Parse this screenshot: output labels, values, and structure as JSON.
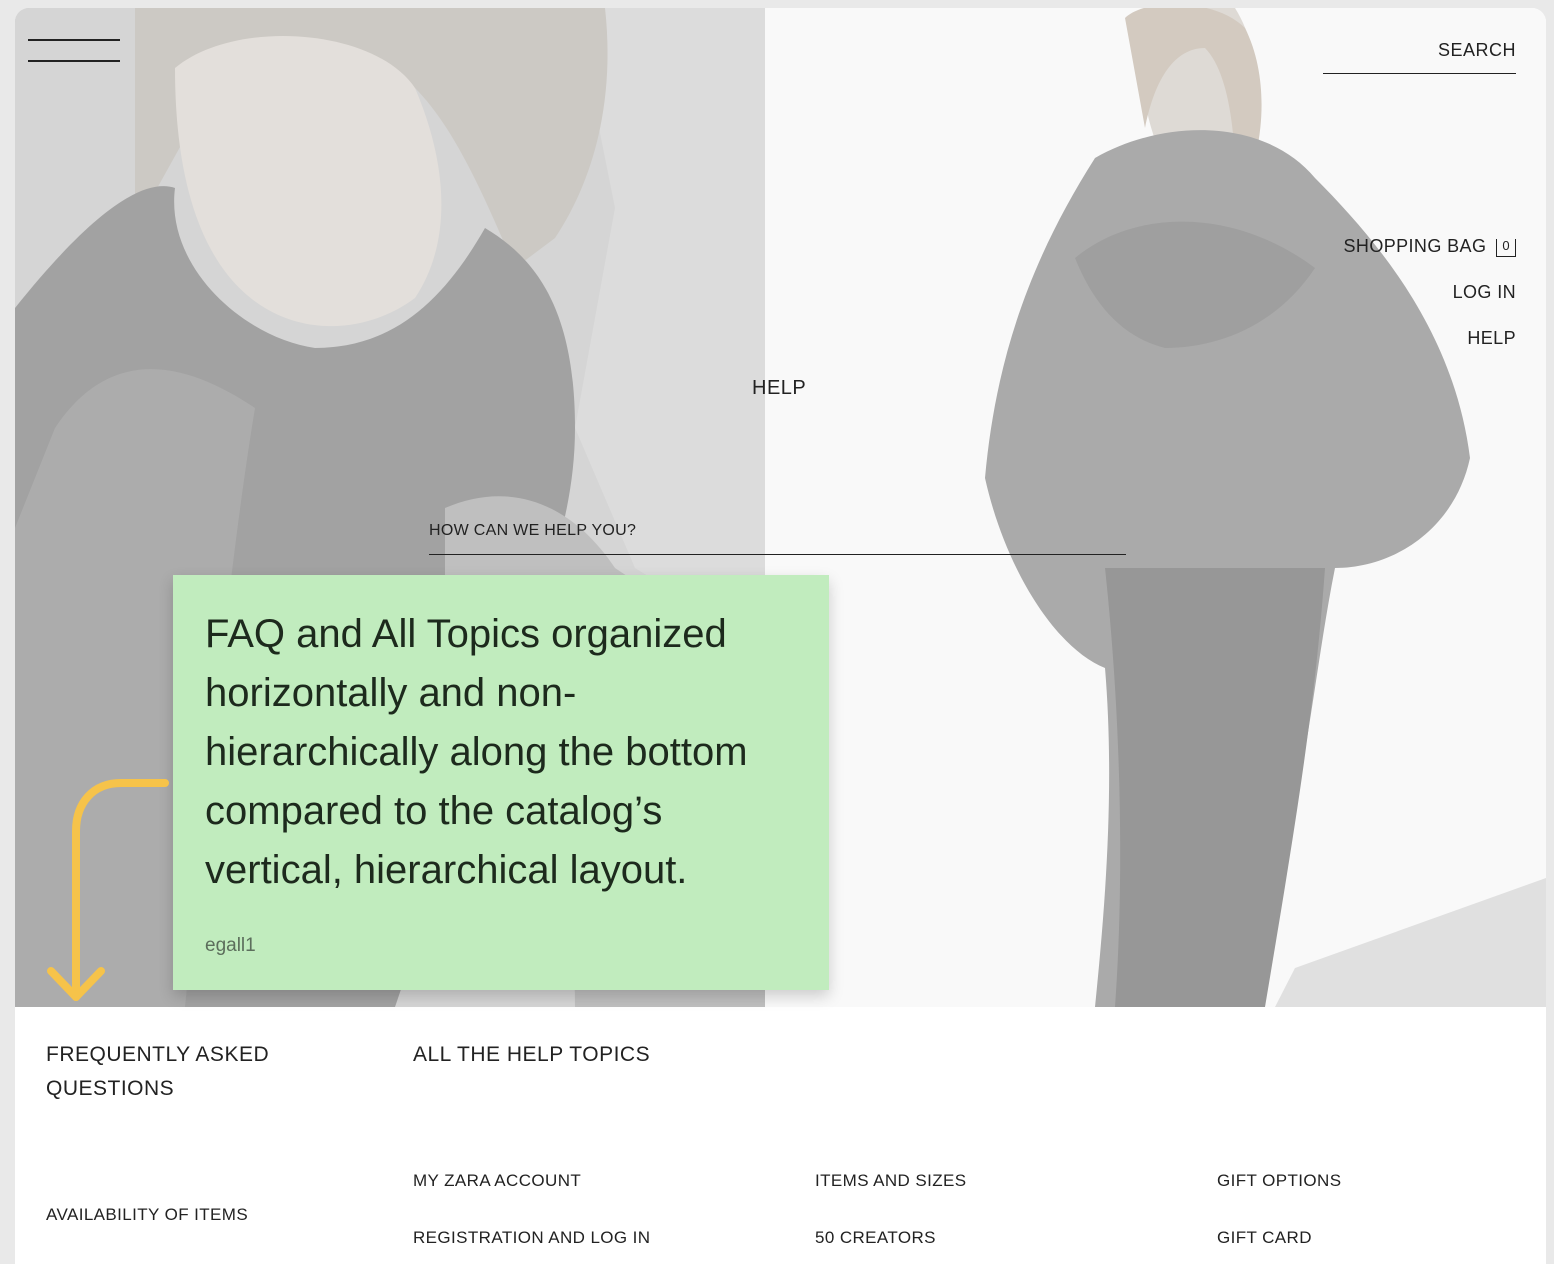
{
  "header": {
    "search_label": "SEARCH",
    "nav": {
      "shopping_bag": "SHOPPING BAG",
      "bag_count": "0",
      "log_in": "LOG IN",
      "help": "HELP"
    }
  },
  "hero": {
    "title": "HELP",
    "search_placeholder": "HOW CAN WE HELP YOU?"
  },
  "annotation": {
    "note": "FAQ and All Topics organized horizontally and non-hierarchically along the bottom compared to the catalog’s vertical, hierarchical layout.",
    "author": "egall1",
    "note_color": "#c1ecbe",
    "arrow_color": "#f6c34a"
  },
  "footer": {
    "faq_title": "FREQUENTLY ASKED QUESTIONS",
    "faq_items": [
      "AVAILABILITY OF ITEMS"
    ],
    "topics_title": "ALL THE HELP TOPICS",
    "topics_columns": [
      [
        "MY ZARA ACCOUNT",
        "REGISTRATION AND LOG IN"
      ],
      [
        "ITEMS AND SIZES",
        "50 CREATORS"
      ],
      [
        "GIFT OPTIONS",
        "GIFT CARD"
      ]
    ]
  }
}
